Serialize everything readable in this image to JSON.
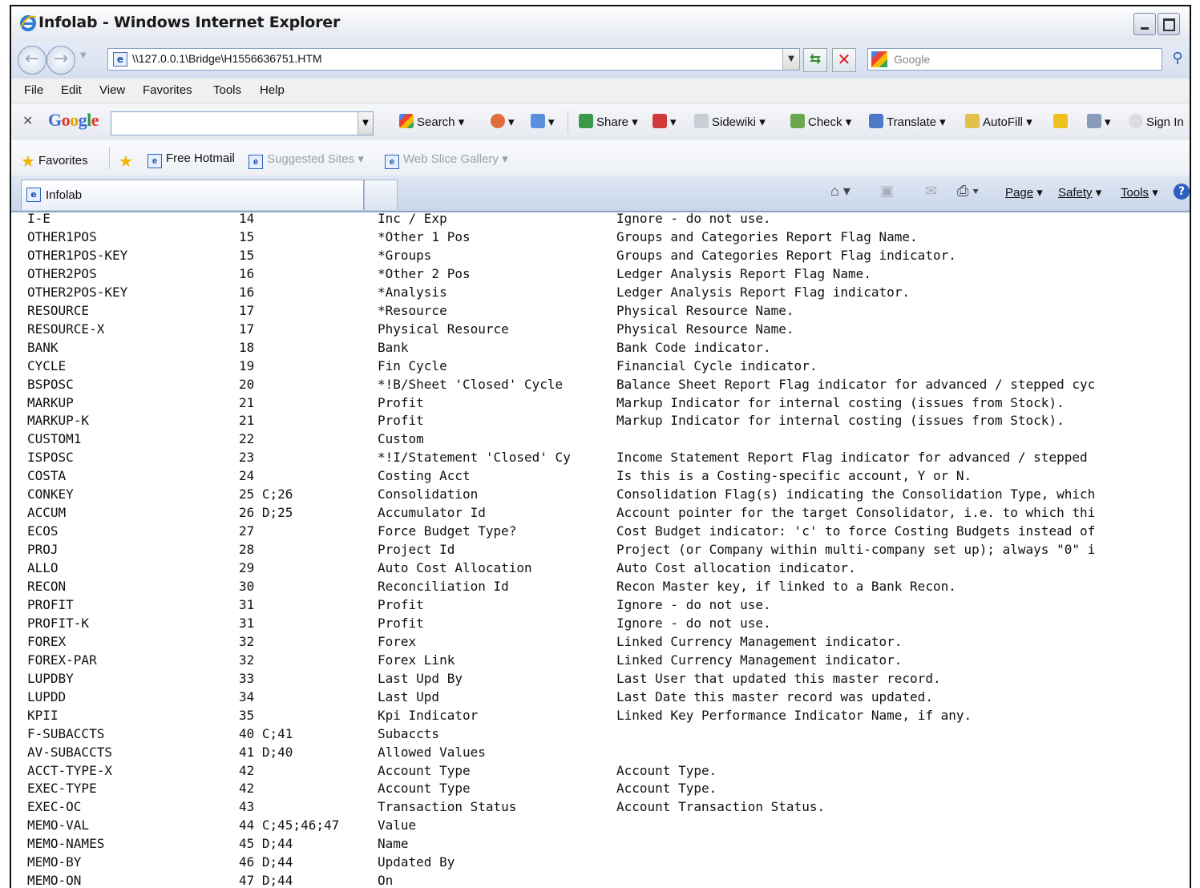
{
  "window": {
    "title": "Infolab - Windows Internet Explorer"
  },
  "address": {
    "url": "\\\\127.0.0.1\\Bridge\\H1556636751.HTM"
  },
  "search": {
    "placeholder": "Google"
  },
  "menu": [
    "File",
    "Edit",
    "View",
    "Favorites",
    "Tools",
    "Help"
  ],
  "google_toolbar": {
    "logo": "Google",
    "search_label": "Search",
    "share_label": "Share",
    "sidewiki_label": "Sidewiki",
    "check_label": "Check",
    "translate_label": "Translate",
    "autofill_label": "AutoFill",
    "signin_label": "Sign In"
  },
  "favorites_bar": {
    "favorites_label": "Favorites",
    "hotmail_label": "Free Hotmail",
    "suggested_label": "Suggested Sites",
    "gallery_label": "Web Slice Gallery"
  },
  "tab": {
    "label": "Infolab"
  },
  "command_bar": {
    "page_label": "Page",
    "safety_label": "Safety",
    "tools_label": "Tools"
  },
  "rows": [
    [
      "I-E",
      "14",
      "Inc / Exp",
      "Ignore - do not use."
    ],
    [
      "OTHER1POS",
      "15",
      "*Other 1 Pos",
      "Groups and Categories Report Flag Name."
    ],
    [
      "OTHER1POS-KEY",
      "15",
      "*Groups",
      "Groups and Categories Report Flag indicator."
    ],
    [
      "OTHER2POS",
      "16",
      "*Other 2 Pos",
      "Ledger Analysis Report Flag Name."
    ],
    [
      "OTHER2POS-KEY",
      "16",
      "*Analysis",
      "Ledger Analysis Report Flag indicator."
    ],
    [
      "RESOURCE",
      "17",
      "*Resource",
      "Physical Resource Name."
    ],
    [
      "RESOURCE-X",
      "17",
      "Physical Resource",
      "Physical Resource Name."
    ],
    [
      "BANK",
      "18",
      "Bank",
      "Bank Code indicator."
    ],
    [
      "CYCLE",
      "19",
      "Fin Cycle",
      "Financial Cycle indicator."
    ],
    [
      "BSPOSC",
      "20",
      "*!B/Sheet 'Closed' Cycle",
      "Balance Sheet Report Flag indicator for advanced / stepped cyc"
    ],
    [
      "MARKUP",
      "21",
      "Profit",
      "Markup Indicator for internal costing (issues from Stock)."
    ],
    [
      "MARKUP-K",
      "21",
      "Profit",
      "Markup Indicator for internal costing (issues from Stock)."
    ],
    [
      "CUSTOM1",
      "22",
      "Custom",
      ""
    ],
    [
      "ISPOSC",
      "23",
      "*!I/Statement 'Closed' Cy",
      "Income Statement Report Flag indicator for advanced / stepped"
    ],
    [
      "COSTA",
      "24",
      "Costing Acct",
      "Is this is a Costing-specific account, Y or N."
    ],
    [
      "CONKEY",
      "25 C;26",
      "Consolidation",
      "Consolidation Flag(s) indicating the Consolidation Type, which"
    ],
    [
      "ACCUM",
      "26 D;25",
      "Accumulator Id",
      "Account pointer for the target Consolidator, i.e. to which thi"
    ],
    [
      "ECOS",
      "27",
      "Force Budget Type?",
      "Cost Budget indicator: 'c' to force Costing Budgets instead of"
    ],
    [
      "PROJ",
      "28",
      "Project Id",
      "Project (or Company within multi-company set up); always \"0\" i"
    ],
    [
      "ALLO",
      "29",
      "Auto Cost Allocation",
      "Auto Cost allocation indicator."
    ],
    [
      "RECON",
      "30",
      "Reconciliation Id",
      "Recon Master key, if linked to a Bank Recon."
    ],
    [
      "PROFIT",
      "31",
      "Profit",
      "Ignore - do not use."
    ],
    [
      "PROFIT-K",
      "31",
      "Profit",
      "Ignore - do not use."
    ],
    [
      "FOREX",
      "32",
      "Forex",
      "Linked Currency Management indicator."
    ],
    [
      "FOREX-PAR",
      "32",
      "Forex Link",
      "Linked Currency Management indicator."
    ],
    [
      "LUPDBY",
      "33",
      "Last Upd By",
      "Last User that updated this master record."
    ],
    [
      "LUPDD",
      "34",
      "Last Upd",
      "Last Date this master record was updated."
    ],
    [
      "KPII",
      "35",
      "Kpi Indicator",
      "Linked Key Performance Indicator Name, if any."
    ],
    [
      "F-SUBACCTS",
      "40 C;41",
      "Subaccts",
      ""
    ],
    [
      "AV-SUBACCTS",
      "41 D;40",
      "Allowed Values",
      ""
    ],
    [
      "ACCT-TYPE-X",
      "42",
      "Account Type",
      "Account Type."
    ],
    [
      "EXEC-TYPE",
      "42",
      "Account Type",
      "Account Type."
    ],
    [
      "EXEC-OC",
      "43",
      "Transaction Status",
      "Account Transaction Status."
    ],
    [
      "MEMO-VAL",
      "44 C;45;46;47",
      "Value",
      ""
    ],
    [
      "MEMO-NAMES",
      "45 D;44",
      "Name",
      ""
    ],
    [
      "MEMO-BY",
      "46 D;44",
      "Updated By",
      ""
    ],
    [
      "MEMO-ON",
      "47 D;44",
      "On",
      ""
    ]
  ]
}
